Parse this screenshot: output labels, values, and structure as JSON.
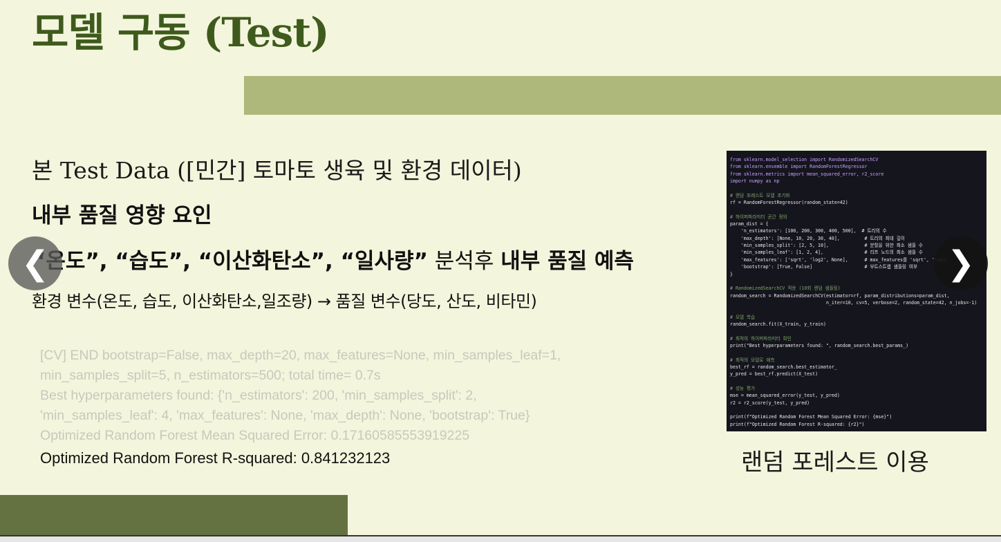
{
  "title": "모델 구동 (Test)",
  "content": {
    "line1": "본 Test Data ([민간] 토마토 생육 및 환경 데이터)",
    "line2": "내부 품질 영향 요인",
    "line3_bold1": "“온도”, “습도”, “이산화탄소”, “일사량”",
    "line3_normal": " 분석후 ",
    "line3_bold2": "내부 품질 예측",
    "line4": "환경 변수(온도, 습도, 이산화탄소,일조량)  →  품질 변수(당도, 산도, 비타민)"
  },
  "log": {
    "lines": [
      "[CV] END bootstrap=False, max_depth=20, max_features=None, min_samples_leaf=1,",
      "min_samples_split=5, n_estimators=500; total time=   0.7s",
      "Best hyperparameters found:  {'n_estimators': 200, 'min_samples_split': 2,",
      "'min_samples_leaf': 4, 'max_features': None, 'max_depth': None, 'bootstrap': True}",
      "Optimized Random Forest Mean Squared Error: 0.17160585553919225"
    ],
    "r_squared": "Optimized Random Forest R-squared: 0.841232123"
  },
  "nav": {
    "prev_glyph": "❮",
    "next_glyph": "❯"
  },
  "code": {
    "lines": [
      {
        "t": "from sklearn.model_selection import RandomizedSearchCV",
        "k": "k"
      },
      {
        "t": "from sklearn.ensemble import RandomForestRegressor",
        "k": "k"
      },
      {
        "t": "from sklearn.metrics import mean_squared_error, r2_score",
        "k": "k"
      },
      {
        "t": "import numpy as np",
        "k": "k"
      },
      {
        "t": "",
        "k": ""
      },
      {
        "t": "# 랜덤 포레스트 모델 초기화",
        "k": "c"
      },
      {
        "t": "rf = RandomForestRegressor(random_state=42)",
        "k": "s"
      },
      {
        "t": "",
        "k": ""
      },
      {
        "t": "# 하이퍼파라미터 공간 정의",
        "k": "c"
      },
      {
        "t": "param_dist = {",
        "k": "s"
      },
      {
        "t": "    'n_estimators': [100, 200, 300, 400, 500],  # 트리의 수",
        "k": "s"
      },
      {
        "t": "    'max_depth': [None, 10, 20, 30, 40],         # 트리의 최대 깊이",
        "k": "s"
      },
      {
        "t": "    'min_samples_split': [2, 5, 10],             # 분할을 위한 최소 샘플 수",
        "k": "s"
      },
      {
        "t": "    'min_samples_leaf': [1, 2, 4],               # 리프 노드의 최소 샘플 수",
        "k": "s"
      },
      {
        "t": "    'max_features': ['sqrt', 'log2', None],      # max_features를 'sqrt', 'log2'",
        "k": "s"
      },
      {
        "t": "    'bootstrap': [True, False]                   # 부트스트랩 샘플링 여부",
        "k": "s"
      },
      {
        "t": "}",
        "k": "s"
      },
      {
        "t": "",
        "k": ""
      },
      {
        "t": "# RandomizedSearchCV 적용 (10회 랜덤 샘플링)",
        "k": "c"
      },
      {
        "t": "random_search = RandomizedSearchCV(estimator=rf, param_distributions=param_dist,",
        "k": "s"
      },
      {
        "t": "                                   n_iter=10, cv=5, verbose=2, random_state=42, n_jobs=-1)",
        "k": "s"
      },
      {
        "t": "",
        "k": ""
      },
      {
        "t": "# 모델 학습",
        "k": "c"
      },
      {
        "t": "random_search.fit(X_train, y_train)",
        "k": "s"
      },
      {
        "t": "",
        "k": ""
      },
      {
        "t": "# 최적의 하이퍼파라미터 확인",
        "k": "c"
      },
      {
        "t": "print(\"Best hyperparameters found: \", random_search.best_params_)",
        "k": "s"
      },
      {
        "t": "",
        "k": ""
      },
      {
        "t": "# 최적의 모델로 예측",
        "k": "c"
      },
      {
        "t": "best_rf = random_search.best_estimator_",
        "k": "s"
      },
      {
        "t": "y_pred = best_rf.predict(X_test)",
        "k": "s"
      },
      {
        "t": "",
        "k": ""
      },
      {
        "t": "# 성능 평가",
        "k": "c"
      },
      {
        "t": "mse = mean_squared_error(y_test, y_pred)",
        "k": "s"
      },
      {
        "t": "r2 = r2_score(y_test, y_pred)",
        "k": "s"
      },
      {
        "t": "",
        "k": ""
      },
      {
        "t": "print(f\"Optimized Random Forest Mean Squared Error: {mse}\")",
        "k": "s"
      },
      {
        "t": "print(f\"Optimized Random Forest R-squared: {r2}\")",
        "k": "s"
      }
    ],
    "caption": "랜덤 포레스트 이용"
  }
}
